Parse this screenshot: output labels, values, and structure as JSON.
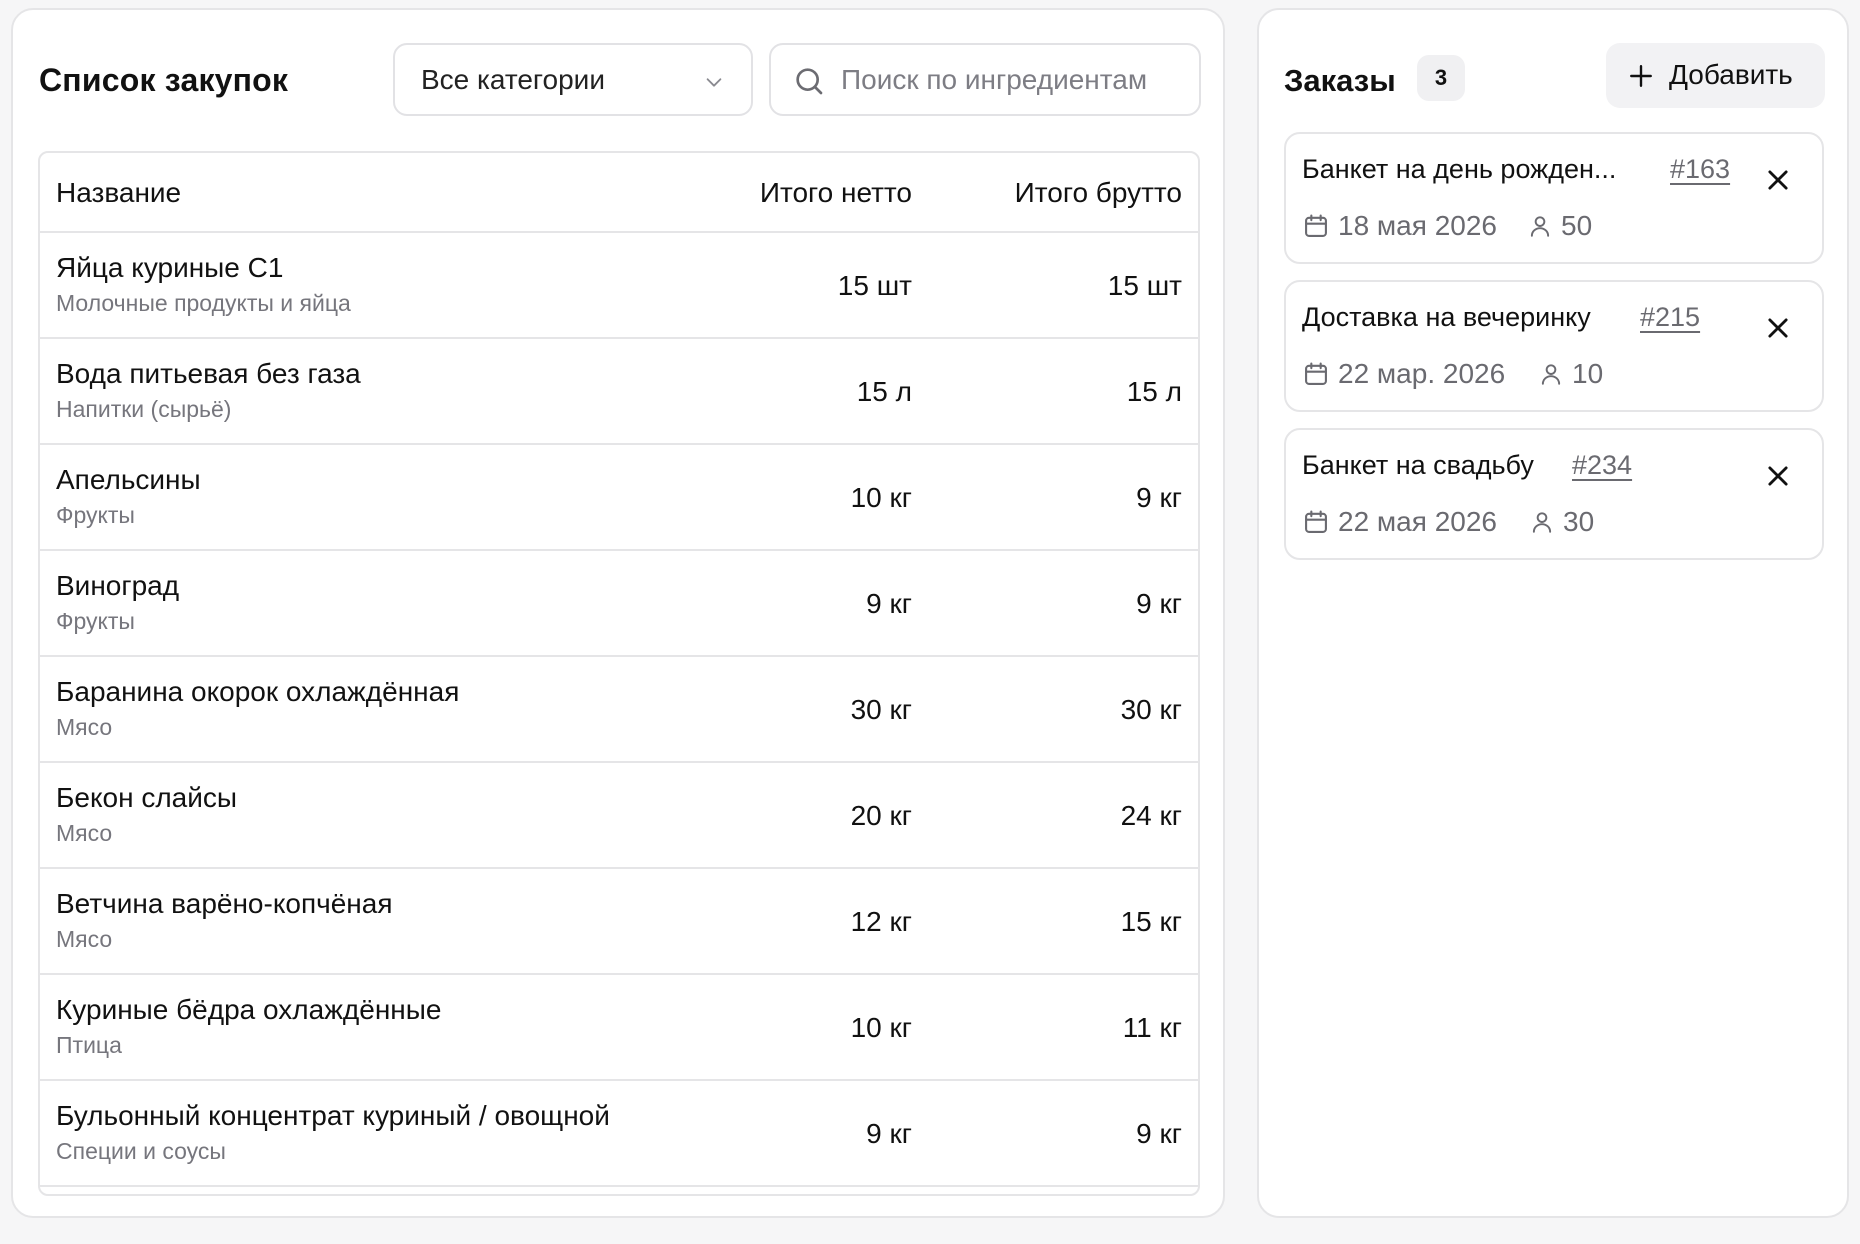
{
  "shopping": {
    "title": "Список закупок",
    "category_select": {
      "value": "Все категории"
    },
    "search": {
      "placeholder": "Поиск по ингредиентам"
    },
    "columns": {
      "name": "Название",
      "net": "Итого нетто",
      "gross": "Итого брутто"
    },
    "rows": [
      {
        "name": "Яйца куриные С1",
        "category": "Молочные продукты и яйца",
        "net": "15 шт",
        "gross": "15 шт"
      },
      {
        "name": "Вода питьевая без газа",
        "category": "Напитки (сырьё)",
        "net": "15 л",
        "gross": "15 л"
      },
      {
        "name": "Апельсины",
        "category": "Фрукты",
        "net": "10 кг",
        "gross": "9 кг"
      },
      {
        "name": "Виноград",
        "category": "Фрукты",
        "net": "9 кг",
        "gross": "9 кг"
      },
      {
        "name": "Баранина окорок охлаждённая",
        "category": "Мясо",
        "net": "30 кг",
        "gross": "30 кг"
      },
      {
        "name": "Бекон слайсы",
        "category": "Мясо",
        "net": "20 кг",
        "gross": "24 кг"
      },
      {
        "name": "Ветчина варёно-копчёная",
        "category": "Мясо",
        "net": "12 кг",
        "gross": "15 кг"
      },
      {
        "name": "Куриные бёдра охлаждённые",
        "category": "Птица",
        "net": "10 кг",
        "gross": "11 кг"
      },
      {
        "name": "Бульонный концентрат куриный / овощной",
        "category": "Специи и соусы",
        "net": "9 кг",
        "gross": "9 кг"
      }
    ]
  },
  "orders": {
    "title": "Заказы",
    "count": "3",
    "add_label": "Добавить",
    "items": [
      {
        "title": "Банкет на день рожден...",
        "number": "#163",
        "date": "18 мая 2026",
        "guests": "50"
      },
      {
        "title": "Доставка на вечеринку",
        "number": "#215",
        "date": "22 мар. 2026",
        "guests": "10"
      },
      {
        "title": "Банкет на свадьбу",
        "number": "#234",
        "date": "22 мая 2026",
        "guests": "30"
      }
    ]
  },
  "icons": {
    "category_select": "chevron-down-icon",
    "search": "search-icon",
    "add": "plus-icon",
    "order_close": "close-icon",
    "order_date": "calendar-icon",
    "order_guests": "person-icon"
  }
}
